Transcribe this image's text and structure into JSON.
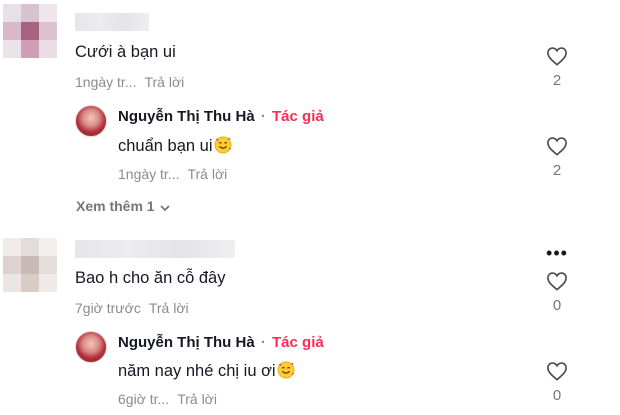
{
  "comments": [
    {
      "text": "Cưới à bạn ui",
      "time": "1ngày tr...",
      "reply_label": "Trả lời",
      "like_count": "2",
      "replies": [
        {
          "author": "Nguyễn Thị Thu Hà",
          "separator": "·",
          "author_tag": "Tác giả",
          "text": "chuẩn bạn ui",
          "emoji": "smiling-face-with-hearts",
          "time": "1ngày tr...",
          "reply_label": "Trả lời",
          "like_count": "2"
        }
      ],
      "view_more_label": "Xem thêm 1"
    },
    {
      "text": "Bao h cho ăn cỗ đây",
      "time": "7giờ trước",
      "reply_label": "Trả lời",
      "like_count": "0",
      "more_label": "•••",
      "replies": [
        {
          "author": "Nguyễn Thị Thu Hà",
          "separator": "·",
          "author_tag": "Tác giả",
          "text": "năm nay nhé chị iu ơi",
          "emoji": "smiling-face-with-hearts",
          "time": "6giờ tr...",
          "reply_label": "Trả lời",
          "like_count": "0"
        }
      ]
    }
  ],
  "colors": {
    "author_tag": "#fe2c55",
    "meta_text": "#8a8b91",
    "primary_text": "#161823"
  }
}
